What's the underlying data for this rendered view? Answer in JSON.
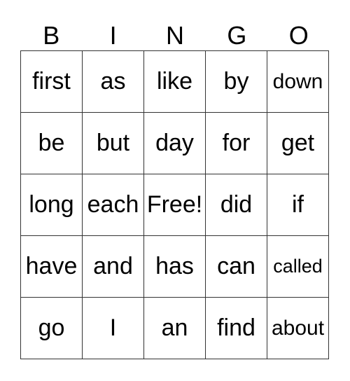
{
  "header": [
    "B",
    "I",
    "N",
    "G",
    "O"
  ],
  "rows": [
    [
      "first",
      "as",
      "like",
      "by",
      "down"
    ],
    [
      "be",
      "but",
      "day",
      "for",
      "get"
    ],
    [
      "long",
      "each",
      "Free!",
      "did",
      "if"
    ],
    [
      "have",
      "and",
      "has",
      "can",
      "called"
    ],
    [
      "go",
      "I",
      "an",
      "find",
      "about"
    ]
  ]
}
